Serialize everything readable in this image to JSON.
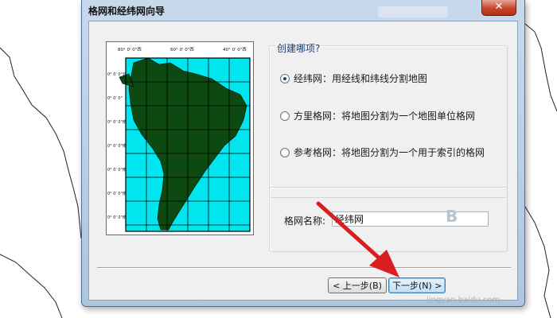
{
  "dialog": {
    "title": "格网和经纬网向导",
    "close_glyph": "✕",
    "question": "创建哪项?",
    "options": [
      {
        "label": "经纬网：用经线和纬线分割地图",
        "checked": true
      },
      {
        "label": "方里格网：将地图分割为一个地图单位格网",
        "checked": false
      },
      {
        "label": "参考格网：将地图分割为一个用于索引的格网",
        "checked": false
      }
    ],
    "grid_name_label": "格网名称:",
    "grid_name_value": "经纬网",
    "buttons": {
      "back": "< 上一步(B)",
      "next": "下一步(N) >"
    }
  },
  "preview_map": {
    "top_labels": [
      "80° 0' 0\"西",
      "60° 0' 0\"西",
      "40° 0' 0\"西"
    ],
    "left_labels": [
      "0° 0' 0\"北",
      "0° 0' 0\"",
      "0° 0' 0\"南",
      "0° 0' 0\"南",
      "0° 0' 0\"南",
      "0° 0' 0\"南",
      "0° 0' 0\"南"
    ],
    "ocean_color": "#00e5ee",
    "land_color": "#0c4a12",
    "grid_color": "#000000"
  },
  "annotation": {
    "arrow_color": "#d81e1e",
    "watermark": "jingyan.baidu.com",
    "watermark_glyph": "B"
  }
}
